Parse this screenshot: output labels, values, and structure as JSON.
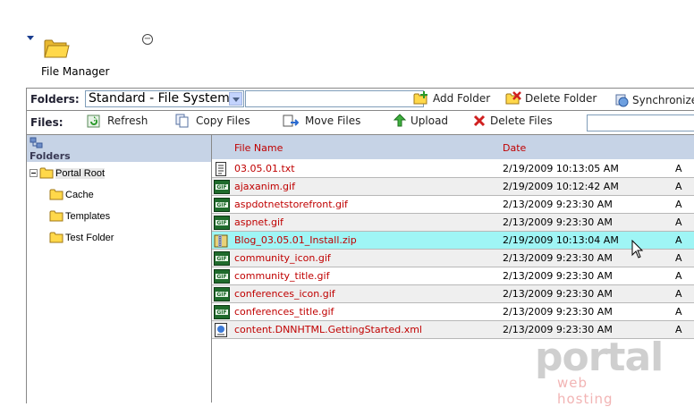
{
  "app": {
    "title": "File Manager"
  },
  "folders_bar": {
    "label": "Folders:",
    "selected_provider": "Standard - File System",
    "add_folder": "Add Folder",
    "delete_folder": "Delete Folder",
    "synchronize": "Synchronize"
  },
  "files_bar": {
    "label": "Files:",
    "refresh": "Refresh",
    "copy_files": "Copy Files",
    "move_files": "Move Files",
    "upload": "Upload",
    "delete_files": "Delete Files"
  },
  "tree": {
    "header": "Folders",
    "root": "Portal Root",
    "children": [
      "Cache",
      "Templates",
      "Test Folder"
    ]
  },
  "list": {
    "columns": {
      "name": "File Name",
      "date": "Date"
    },
    "files": [
      {
        "icon": "text-file-icon",
        "name": "03.05.01.txt",
        "date": "2/19/2009 10:13:05 AM",
        "attr": "A"
      },
      {
        "icon": "gif-file-icon",
        "name": "ajaxanim.gif",
        "date": "2/19/2009 10:12:42 AM",
        "attr": "A"
      },
      {
        "icon": "gif-file-icon",
        "name": "aspdotnetstorefront.gif",
        "date": "2/13/2009 9:23:30 AM",
        "attr": "A"
      },
      {
        "icon": "gif-file-icon",
        "name": "aspnet.gif",
        "date": "2/13/2009 9:23:30 AM",
        "attr": "A"
      },
      {
        "icon": "zip-file-icon",
        "name": "Blog_03.05.01_Install.zip",
        "date": "2/19/2009 10:13:04 AM",
        "attr": "A"
      },
      {
        "icon": "gif-file-icon",
        "name": "community_icon.gif",
        "date": "2/13/2009 9:23:30 AM",
        "attr": "A"
      },
      {
        "icon": "gif-file-icon",
        "name": "community_title.gif",
        "date": "2/13/2009 9:23:30 AM",
        "attr": "A"
      },
      {
        "icon": "gif-file-icon",
        "name": "conferences_icon.gif",
        "date": "2/13/2009 9:23:30 AM",
        "attr": "A"
      },
      {
        "icon": "gif-file-icon",
        "name": "conferences_title.gif",
        "date": "2/13/2009 9:23:30 AM",
        "attr": "A"
      },
      {
        "icon": "xml-file-icon",
        "name": "content.DNNHTML.GettingStarted.xml",
        "date": "2/13/2009 9:23:30 AM",
        "attr": "A"
      }
    ]
  },
  "watermark": {
    "brand": "portal",
    "tagline": "web hosting"
  },
  "colors": {
    "header_bg": "#c6d3e6",
    "link_red": "#c00000",
    "hover_row": "#9ff5f5",
    "alt_row": "#efefef"
  }
}
